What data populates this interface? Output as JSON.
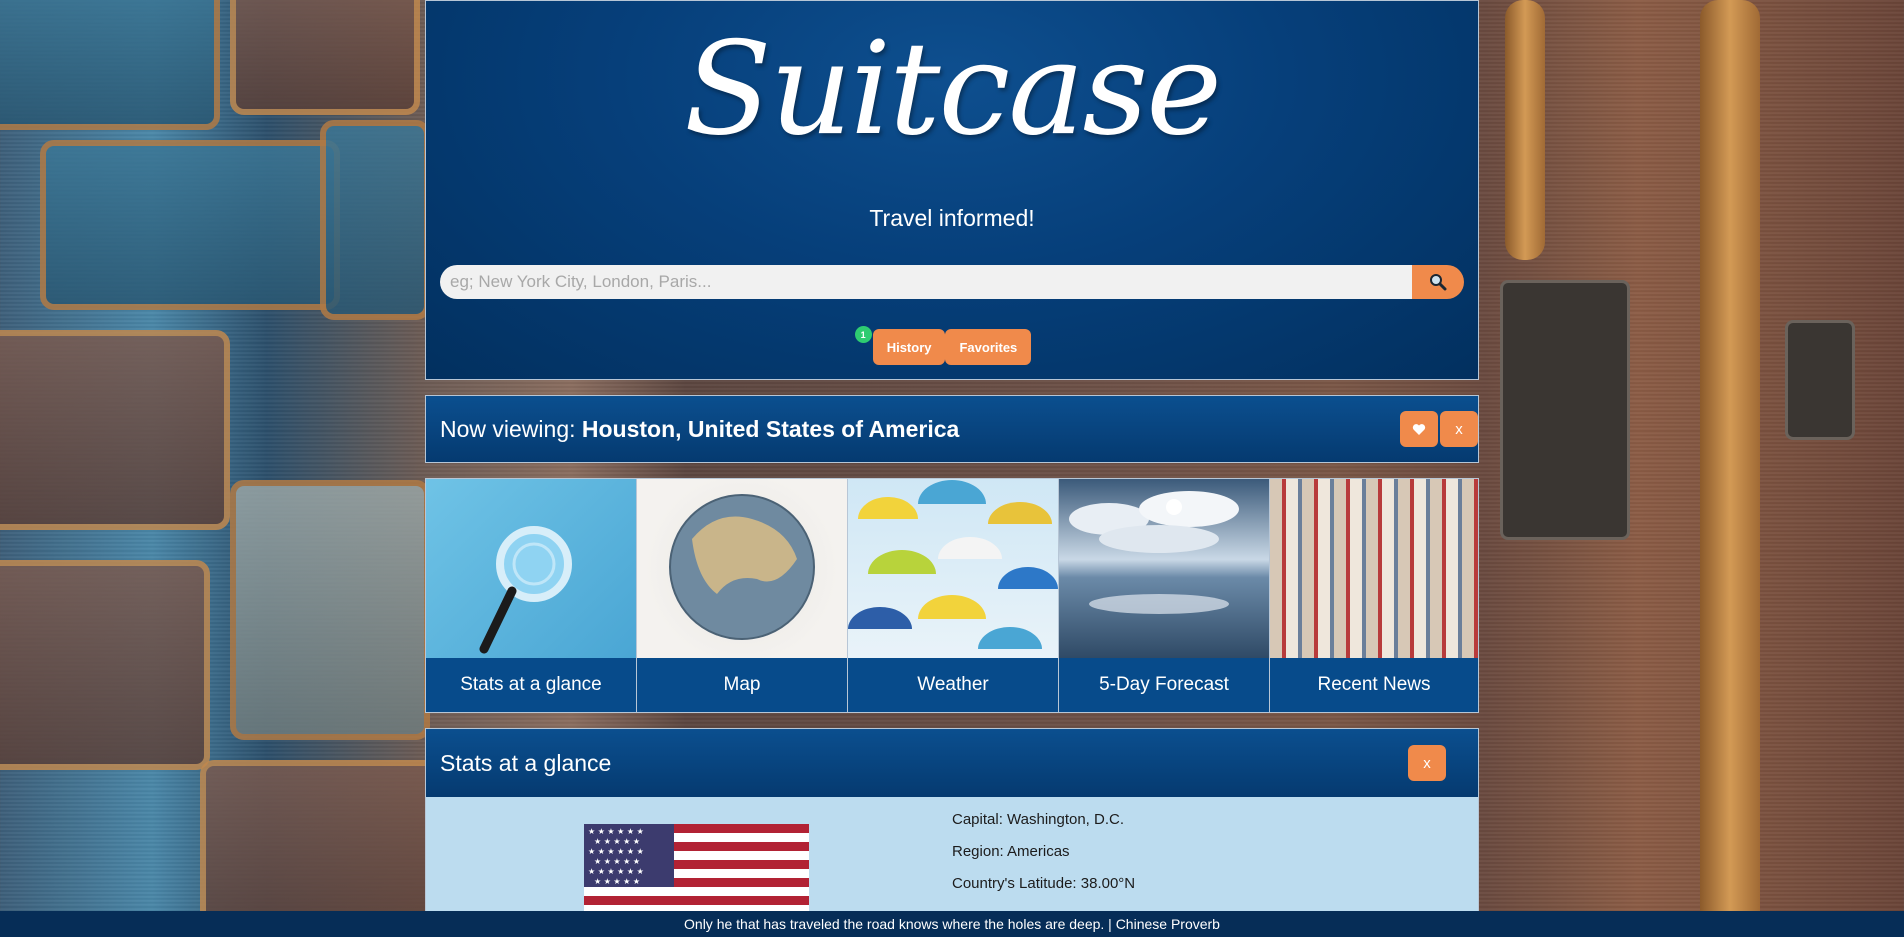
{
  "header": {
    "logo": "Suitcase",
    "tagline": "Travel informed!"
  },
  "search": {
    "placeholder": "eg; New York City, London, Paris...",
    "value": "",
    "button_icon": "search-icon"
  },
  "nav": {
    "history_label": "History",
    "history_badge": "1",
    "favorites_label": "Favorites"
  },
  "viewing": {
    "prefix": "Now viewing:",
    "location": "Houston, United States of America",
    "favorite_icon": "heart-icon",
    "close_label": "x"
  },
  "tiles": [
    {
      "label": "Stats at a glance",
      "icon": "magnifier-image"
    },
    {
      "label": "Map",
      "icon": "globe-image"
    },
    {
      "label": "Weather",
      "icon": "umbrellas-image"
    },
    {
      "label": "5-Day Forecast",
      "icon": "sky-image"
    },
    {
      "label": "Recent News",
      "icon": "newspapers-image"
    }
  ],
  "stats": {
    "title": "Stats at a glance",
    "close_label": "x",
    "facts": [
      "Capital: Washington, D.C.",
      "Region: Americas",
      "Country's Latitude: 38.00°N"
    ]
  },
  "footer": {
    "quote": "Only he that has traveled the road knows where the holes are deep. | Chinese Proverb"
  },
  "colors": {
    "accent": "#f08a4b",
    "header_blue": "#063f7a",
    "panel_light_blue": "#bcdcef",
    "badge_green": "#2ecc71",
    "footer_navy": "#062d57"
  }
}
